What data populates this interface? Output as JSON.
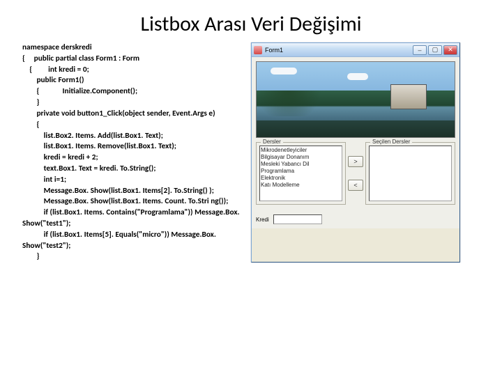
{
  "title": "Listbox Arası Veri Değişimi",
  "code": "namespace derskredi\n{     public partial class Form1 : Form\n    {         int kredi = 0;\n        public Form1()\n        {             Initialize.Component();\n        }\n        private void button1_Click(object sender, Event.Args e)\n        {\n            list.Box2. Items. Add(list.Box1. Text);\n            list.Box1. Items. Remove(list.Box1. Text);\n            kredi = kredi + 2;\n            text.Box1. Text = kredi. To.String();\n            int i=1;\n            Message.Box. Show(list.Box1. Items[2]. To.String() );\n            Message.Box. Show(list.Box1. Items. Count. To.Stri ng());\n            if (list.Box1. Items. Contains(\"Programlama\")) Message.Box. Show(\"test1\");\n            if (list.Box1. Items[5]. Equals(\"micro\")) Message.Box. Show(\"test2\");\n        }",
  "window": {
    "title": "Form1",
    "minimize": "–",
    "maximize": "▢",
    "close": "✕",
    "group_left": "Dersler",
    "group_right": "Seçilen Dersler",
    "listbox_items": "Mikrodenetleyiciler\nBilgisayar Donanım\nMesleki Yabancı Dil\nProgramlama\nElektronik\nKatı Modelleme",
    "btn_right": ">",
    "btn_left": "<",
    "kredi_label": "Kredi"
  }
}
